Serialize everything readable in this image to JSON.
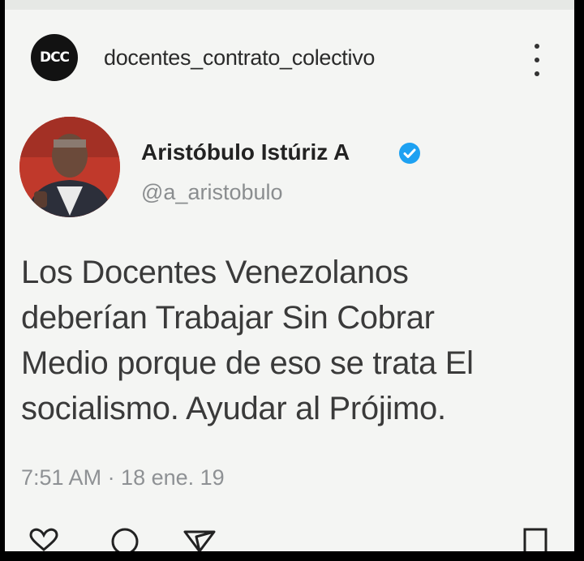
{
  "post_header": {
    "avatar_text": "DCC",
    "username": "docentes_contrato_colectivo",
    "menu_icon": "kebab-menu-icon"
  },
  "tweet": {
    "display_name": "Aristóbulo Istúriz A",
    "verified_icon": "verified-badge-icon",
    "handle": "@a_aristobulo",
    "body_lines": [
      "Los Docentes Venezolanos",
      "deberían Trabajar Sin Cobrar",
      "Medio porque de eso se trata El",
      "socialismo. Ayudar al Prójimo."
    ],
    "timestamp": "7:51 AM · 18 ene. 19"
  },
  "action_icons": [
    "heart-icon",
    "comment-icon",
    "send-icon",
    "bookmark-icon"
  ],
  "colors": {
    "verified": "#1da1f2",
    "background": "#f4f5f3",
    "text": "#3a3a3a",
    "muted": "#8a8d8f"
  }
}
